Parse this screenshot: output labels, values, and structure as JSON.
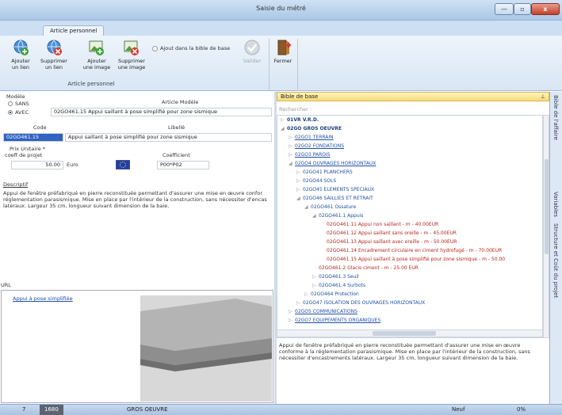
{
  "window": {
    "title": "Saisie du métré",
    "min": "—",
    "max": "▫",
    "close": "x"
  },
  "ribbon": {
    "tab": "Article personnel",
    "group": "Article personnel",
    "add_link": [
      "Ajouter",
      "un lien"
    ],
    "del_link": [
      "Supprimer",
      "un lien"
    ],
    "add_image": [
      "Ajouter",
      "une image"
    ],
    "del_image": [
      "Supprimer",
      "une image"
    ],
    "add_bible": "Ajout dans la bible de base",
    "validate": "Valider",
    "close": "Fermer",
    "collapse_icon": "^"
  },
  "form": {
    "modele_label": "Modèle",
    "sans": "SANS",
    "avec": "AVEC",
    "article_modele_label": "Article Modèle",
    "article_modele_value": "02GO461.15 Appui saillant à pose simplifié pour zone sismique",
    "code_label": "Code",
    "libelle_label": "Libellé",
    "code_value": "02GO461.15",
    "libelle_value": "Appui saillant à pose simplifié pour zone sismique",
    "prix_label": "Prix Unitaire *",
    "coeff_projet_label": "coeff de projet",
    "coefficient_label": "Coefficient",
    "prix_value": "50.00",
    "currency": "Euro",
    "coefficient_value": "P00*P02",
    "descriptif_label": "Descriptif",
    "descriptif": "Appui de fenêtre préfabriqué en pierre reconstituée permettant d'assurer une mise en œuvre confor réglementation parasismique. Mise en place par l'intérieur de la construction, sans nécessiter d'encas latéraux. Largeur 35 cm, longueur suivant dimension de la baie.",
    "url_label": "URL",
    "url_link": "Appui à pose simplifiée"
  },
  "bible": {
    "header": "Bible de base",
    "search_placeholder": "Rechercher :",
    "tree": [
      {
        "text": "01VR V.R.D.",
        "style": "b",
        "indent": 0,
        "ex": "▷"
      },
      {
        "text": "02GO GROS OEUVRE",
        "style": "b",
        "indent": 0,
        "ex": "◢"
      },
      {
        "text": "02GO1 TERRAIN",
        "style": "u",
        "indent": 1,
        "ex": "▷"
      },
      {
        "text": "02GO2 FONDATIONS",
        "style": "u",
        "indent": 1,
        "ex": "▷"
      },
      {
        "text": "02GO3 PAROIS",
        "style": "u",
        "indent": 1,
        "ex": "▷"
      },
      {
        "text": "02GO4 OUVRAGES HORIZONTAUX",
        "style": "u",
        "indent": 1,
        "ex": "◢"
      },
      {
        "text": "02GO41 PLANCHERS",
        "style": "n",
        "indent": 2,
        "ex": "▷"
      },
      {
        "text": "02GO44 SOLS",
        "style": "n",
        "indent": 2,
        "ex": "▷"
      },
      {
        "text": "02GO45 ELEMENTS SPECIAUX",
        "style": "n",
        "indent": 2,
        "ex": "▷"
      },
      {
        "text": "02GO46 SAILLIES ET RETRAIT",
        "style": "n",
        "indent": 2,
        "ex": "◢"
      },
      {
        "text": "02GO461 Ossature",
        "style": "n",
        "indent": 3,
        "ex": "◢"
      },
      {
        "text": "02GO461.1 Appuis",
        "style": "n",
        "indent": 4,
        "ex": "◢"
      },
      {
        "text": "02GO461.11 Appui non saillant - m - 40.00EUR",
        "style": "r",
        "indent": 5,
        "ex": ""
      },
      {
        "text": "02GO461.12 Appui saillant sans oreille - m - 45.00EUR",
        "style": "r",
        "indent": 5,
        "ex": ""
      },
      {
        "text": "02GO461.13 Appui saillant avec oreille - m - 50.00EUR",
        "style": "r",
        "indent": 5,
        "ex": ""
      },
      {
        "text": "02GO461.14 Encadrement circulaire en ciment hydrofugé - m - 70.00EUR",
        "style": "r",
        "indent": 5,
        "ex": ""
      },
      {
        "text": "02GO461.15 Appui saillant à pose simplifié pour zone sismique - m - 50.00",
        "style": "r",
        "indent": 5,
        "ex": ""
      },
      {
        "text": "02GO461.2 Glacis ciment - m - 25.00 EUR",
        "style": "r",
        "indent": 4,
        "ex": ""
      },
      {
        "text": "02GO461.3 Seuil",
        "style": "n",
        "indent": 4,
        "ex": "▷"
      },
      {
        "text": "02GO461.4 Surbots",
        "style": "n",
        "indent": 4,
        "ex": "▷"
      },
      {
        "text": "02GO464 Protection",
        "style": "n",
        "indent": 3,
        "ex": "▷"
      },
      {
        "text": "02GO47 ISOLATION DES OUVRAGES HORIZONTAUX",
        "style": "n",
        "indent": 2,
        "ex": "▷"
      },
      {
        "text": "02GO5 COMMUNICATIONS",
        "style": "u",
        "indent": 1,
        "ex": "▷"
      },
      {
        "text": "02GO7 EQUIPEMENTS ORGANIQUES",
        "style": "u",
        "indent": 1,
        "ex": "▷"
      }
    ],
    "description": "Appui de fenêtre préfabriqué en pierre reconstituée permettant d'assurer une mise en œuvre conforme à la réglementation parasismique. Mise en place par l'intérieur de la construction, sans nécessiter d'encastrements latéraux. Largeur 35 cm, longueur suivant dimension de la baie."
  },
  "side_tabs": [
    "Bible de l'affaire",
    "Variables",
    "Structure et Coût du projet"
  ],
  "status": {
    "a": "7",
    "b": "1680",
    "c": "GROS OEUVRE",
    "d": "Neuf",
    "e": "0%"
  }
}
